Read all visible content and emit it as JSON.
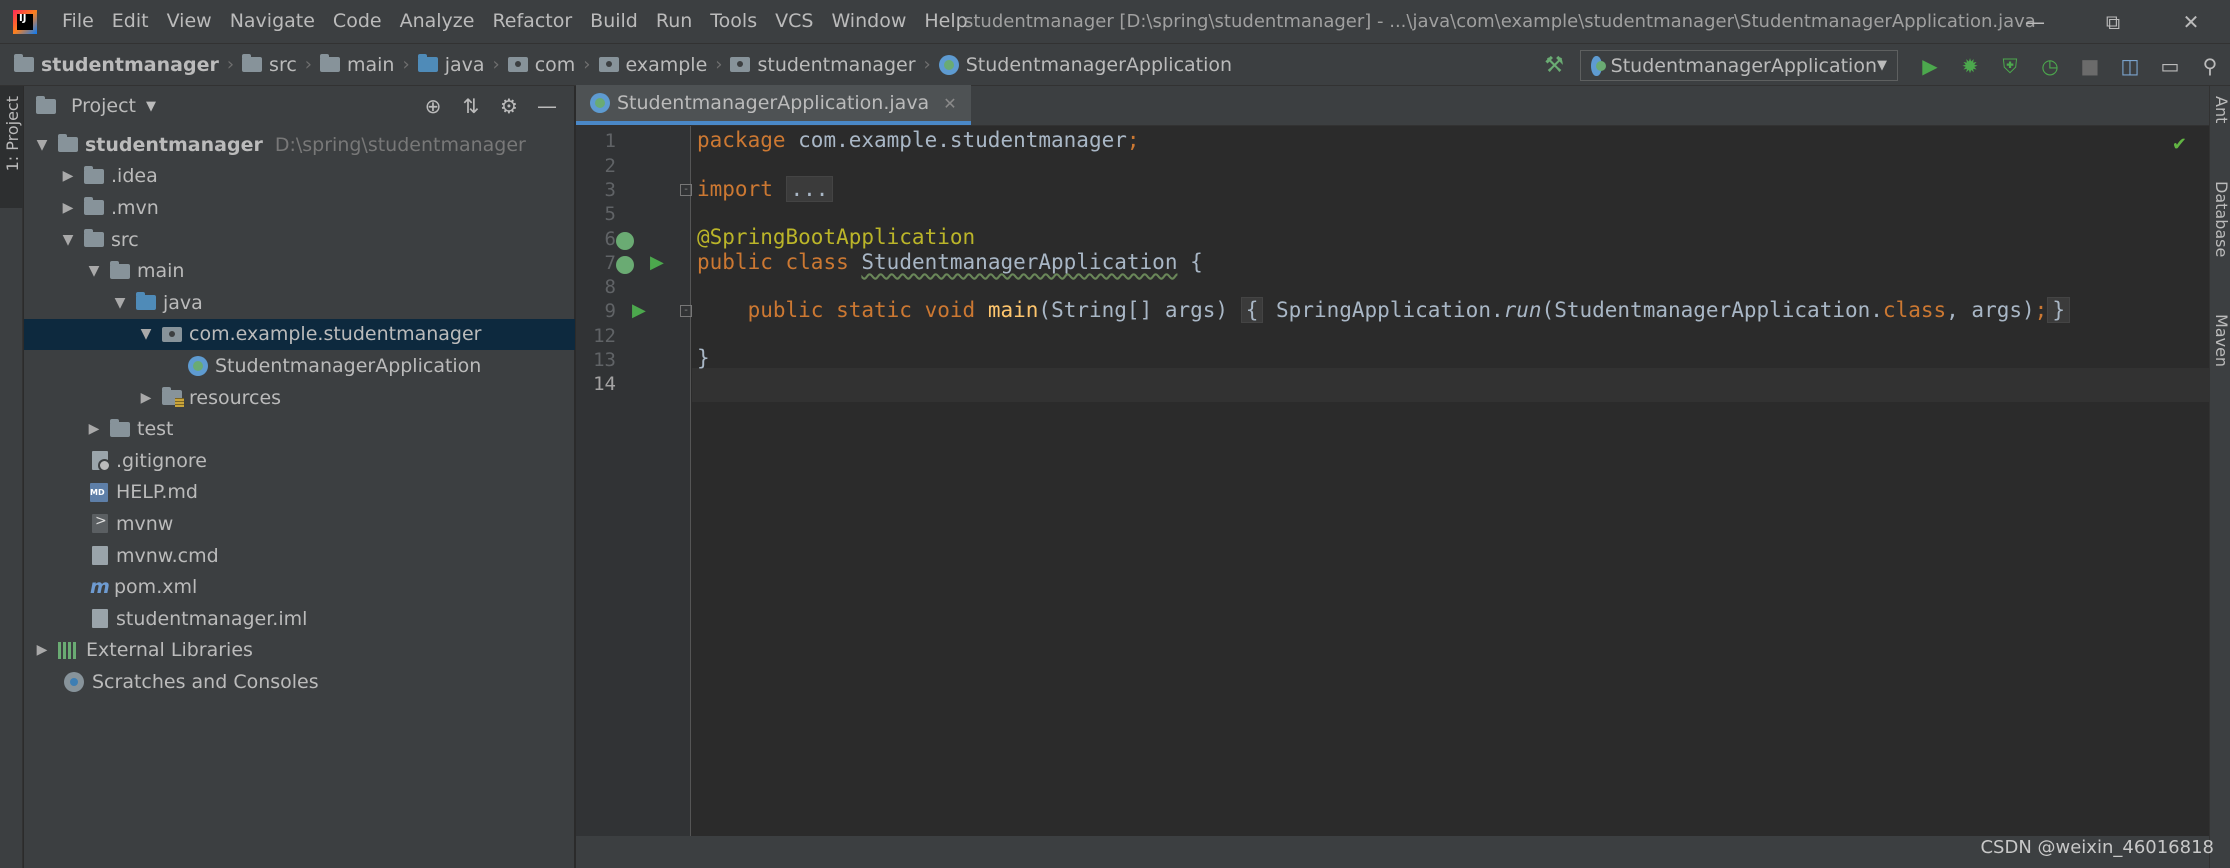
{
  "app": {
    "menu": [
      "File",
      "Edit",
      "View",
      "Navigate",
      "Code",
      "Analyze",
      "Refactor",
      "Build",
      "Run",
      "Tools",
      "VCS",
      "Window",
      "Help"
    ],
    "window_title": "studentmanager [D:\\spring\\studentmanager] - ...\\java\\com\\example\\studentmanager\\StudentmanagerApplication.java"
  },
  "breadcrumbs": [
    "studentmanager",
    "src",
    "main",
    "java",
    "com",
    "example",
    "studentmanager",
    "StudentmanagerApplication"
  ],
  "run_config": {
    "selected": "StudentmanagerApplication"
  },
  "left_strip": {
    "project_tab": "1: Project"
  },
  "project_panel": {
    "title": "Project",
    "root": {
      "name": "studentmanager",
      "path": "D:\\spring\\studentmanager"
    },
    "items": [
      {
        "label": ".idea"
      },
      {
        "label": ".mvn"
      },
      {
        "label": "src"
      },
      {
        "label": "main"
      },
      {
        "label": "java"
      },
      {
        "label": "com.example.studentmanager"
      },
      {
        "label": "StudentmanagerApplication"
      },
      {
        "label": "resources"
      },
      {
        "label": "test"
      },
      {
        "label": ".gitignore"
      },
      {
        "label": "HELP.md"
      },
      {
        "label": "mvnw"
      },
      {
        "label": "mvnw.cmd"
      },
      {
        "label": "pom.xml"
      },
      {
        "label": "studentmanager.iml"
      },
      {
        "label": "External Libraries"
      },
      {
        "label": "Scratches and Consoles"
      }
    ]
  },
  "editor": {
    "tab": "StudentmanagerApplication.java",
    "line_numbers": [
      "1",
      "2",
      "3",
      "5",
      "6",
      "7",
      "8",
      "9",
      "12",
      "13",
      "14"
    ],
    "code": {
      "l1_kw": "package",
      "l1_rest": " com.example.studentmanager",
      "l1_semi": ";",
      "l3_kw": "import",
      "l3_fold": "...",
      "l6_ann": "@SpringBootApplication",
      "l7_kw1": "public",
      "l7_kw2": "class",
      "l7_name": "StudentmanagerApplication",
      "l7_brace": " {",
      "l9_kw1": "public",
      "l9_kw2": "static",
      "l9_kw3": "void",
      "l9_fn": "main",
      "l9_params": "(String[] args)",
      "l9_open": "{",
      "l9_call1": " SpringApplication.",
      "l9_run": "run",
      "l9_call2": "(StudentmanagerApplication.",
      "l9_class": "class",
      "l9_call3": ", args)",
      "l9_semi": ";",
      "l9_close": "}",
      "l13": "}"
    }
  },
  "right_strip": {
    "tabs": [
      "Ant",
      "Database",
      "Maven"
    ]
  },
  "watermark": "CSDN @weixin_46016818"
}
